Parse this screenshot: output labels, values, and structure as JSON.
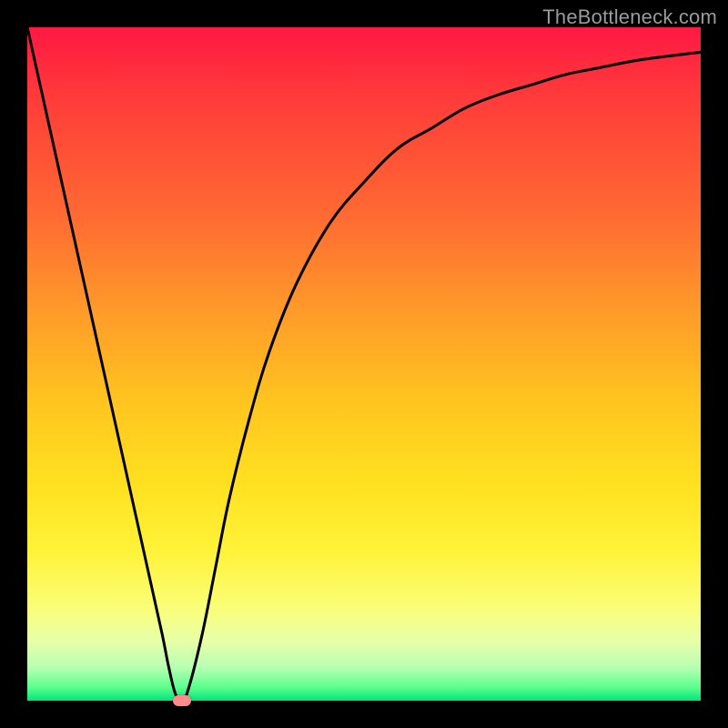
{
  "watermark": "TheBottleneck.com",
  "colors": {
    "curve_stroke": "#000000",
    "marker_fill": "#ff8a8a",
    "frame_bg": "#000000"
  },
  "chart_data": {
    "type": "line",
    "title": "",
    "xlabel": "",
    "ylabel": "",
    "xlim": [
      0,
      100
    ],
    "ylim": [
      0,
      100
    ],
    "grid": false,
    "legend": false,
    "series": [
      {
        "name": "curve",
        "x": [
          0,
          2,
          4,
          6,
          8,
          10,
          12,
          14,
          16,
          18,
          20,
          21,
          22,
          23,
          24,
          26,
          28,
          30,
          33,
          36,
          40,
          45,
          50,
          55,
          60,
          65,
          70,
          75,
          80,
          85,
          90,
          95,
          100
        ],
        "y": [
          100,
          91,
          82,
          73,
          64,
          55,
          46,
          37,
          28,
          19,
          10,
          5,
          1,
          0,
          2,
          10,
          20,
          30,
          42,
          52,
          62,
          71,
          77,
          82,
          85,
          88,
          90,
          91.5,
          93,
          94,
          95,
          95.7,
          96.3
        ]
      }
    ],
    "marker": {
      "x": 23,
      "y": 0
    }
  }
}
